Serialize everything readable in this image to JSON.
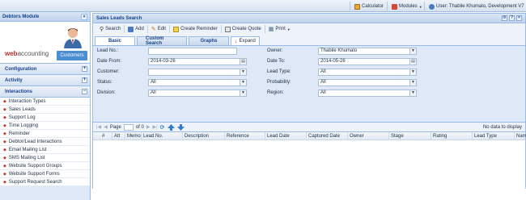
{
  "topbar": {
    "calculator": "Calculator",
    "modules": "Modules",
    "user": "User: Thabile Khumalo, Development V7",
    "colors": {
      "calc_icon": "#e0a030",
      "modules_icon": "#d04040",
      "user_icon": "#4a7bc0"
    }
  },
  "left_panel": {
    "title": "Debtors Module",
    "collapse_symbol": "«",
    "logo_brand": "web",
    "logo_product": "accounting",
    "customers_label": "Customers",
    "sections": [
      {
        "label": "Configuration",
        "symbol": "+"
      },
      {
        "label": "Activity",
        "symbol": "+"
      },
      {
        "label": "Interactions",
        "symbol": "−"
      }
    ],
    "nav_items": [
      "Interaction Types",
      "Sales Leads",
      "Support Log",
      "Time Logging",
      "Reminder",
      "Debtor/Lead Interactions",
      "Email Mailing List",
      "SMS Mailing List",
      "Website Support Groups",
      "Website Support Forms",
      "Support Request Search"
    ]
  },
  "main": {
    "title": "Sales Leads Search",
    "toolbar": {
      "search": "Search",
      "add": "Add",
      "edit": "Edit",
      "create_reminder": "Create Reminder",
      "create_quote": "Create Quote",
      "print": "Print"
    },
    "tabs": {
      "basic": "Basic",
      "custom_search": "Custom Search",
      "graphs": "Graphs",
      "expand": "Expand"
    },
    "form": {
      "lead_no_label": "Lead No.:",
      "lead_no_value": "",
      "date_from_label": "Date From:",
      "date_from_value": "2014-03-26",
      "customer_label": "Customer:",
      "customer_value": "",
      "status_label": "Status:",
      "status_value": "All",
      "division_label": "Division:",
      "division_value": "All",
      "owner_label": "Owner:",
      "owner_value": "Thabile Khumalo",
      "date_to_label": "Date To:",
      "date_to_value": "2014-05-26",
      "lead_type_label": "Lead Type:",
      "lead_type_value": "All",
      "probability_label": "Probability:",
      "probability_value": "All",
      "region_label": "Region:",
      "region_value": "All"
    },
    "pager": {
      "page_label": "Page",
      "page_value": "",
      "of_label": "of 0",
      "no_data": "No data to display"
    },
    "grid_columns": [
      "#",
      "Att",
      "Memo",
      "Lead No.",
      "Description",
      "Reference",
      "Lead Date",
      "Captured Date",
      "Owner",
      "Stage",
      "Rating",
      "Lead Type",
      "Nam"
    ]
  }
}
